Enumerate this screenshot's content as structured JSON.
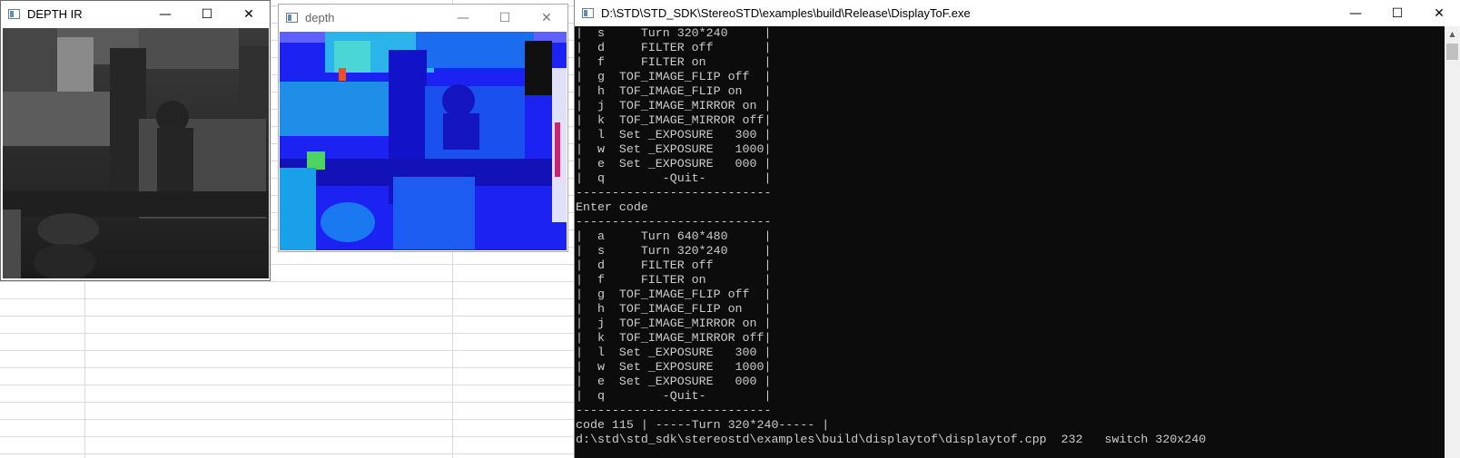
{
  "background_sheet": {
    "grid_color": "#dadce0"
  },
  "windows": {
    "depth_ir": {
      "title": "DEPTH IR",
      "controls": {
        "minimize": "—",
        "maximize": "☐",
        "close": "✕"
      }
    },
    "depth": {
      "title": "depth",
      "controls": {
        "minimize": "—",
        "maximize": "☐",
        "close": "✕"
      }
    },
    "console": {
      "title": "D:\\STD\\STD_SDK\\StereoSTD\\examples\\build\\Release\\DisplayToF.exe",
      "controls": {
        "minimize": "—",
        "maximize": "☐",
        "close": "✕"
      },
      "scroll_up": "▲",
      "lines": [
        "|  s     Turn 320*240     |",
        "|  d     FILTER off       |",
        "|  f     FILTER on        |",
        "|  g  TOF_IMAGE_FLIP off  |",
        "|  h  TOF_IMAGE_FLIP on   |",
        "|  j  TOF_IMAGE_MIRROR on |",
        "|  k  TOF_IMAGE_MIRROR off|",
        "|  l  Set _EXPOSURE   300 |",
        "|  w  Set _EXPOSURE   1000|",
        "|  e  Set _EXPOSURE   000 |",
        "|  q        -Quit-        |",
        "---------------------------",
        "Enter code",
        "---------------------------",
        "|  a     Turn 640*480     |",
        "|  s     Turn 320*240     |",
        "|  d     FILTER off       |",
        "|  f     FILTER on        |",
        "|  g  TOF_IMAGE_FLIP off  |",
        "|  h  TOF_IMAGE_FLIP on   |",
        "|  j  TOF_IMAGE_MIRROR on |",
        "|  k  TOF_IMAGE_MIRROR off|",
        "|  l  Set _EXPOSURE   300 |",
        "|  w  Set _EXPOSURE   1000|",
        "|  e  Set _EXPOSURE   000 |",
        "|  q        -Quit-        |",
        "---------------------------",
        "code 115 | -----Turn 320*240----- |",
        "d:\\std\\std_sdk\\stereostd\\examples\\build\\displaytof\\displaytof.cpp  232   switch 320x240"
      ]
    }
  },
  "colors": {
    "console_bg": "#0c0c0c",
    "console_fg": "#cccccc",
    "depth_blue": "#1a1cf0",
    "depth_cyan": "#19c9e8",
    "ir_dark": "#2c2c2c"
  }
}
